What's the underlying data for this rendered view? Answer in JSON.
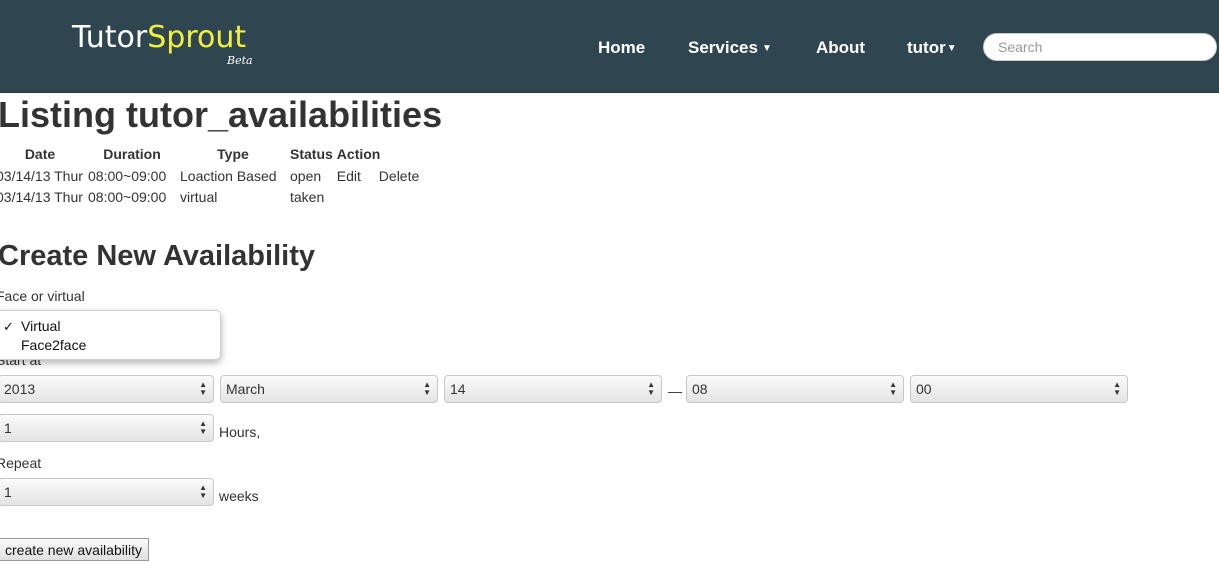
{
  "brand": {
    "name_part1": "Tutor",
    "name_part2": "Sprout",
    "tag": "Beta"
  },
  "nav": {
    "home": "Home",
    "services": "Services",
    "about": "About",
    "user": "tutor",
    "search_placeholder": "Search"
  },
  "colors": {
    "navbar": "#2f4650",
    "brand_accent": "#f4f13a"
  },
  "page_title": "Listing tutor_availabilities",
  "table": {
    "headers": [
      "Date",
      "Duration",
      "Type",
      "Status",
      "Action"
    ],
    "rows": [
      {
        "date": "03/14/13 Thur",
        "duration": "08:00~09:00",
        "type": "Loaction Based",
        "status": "open",
        "edit": "Edit",
        "delete": "Delete"
      },
      {
        "date": "03/14/13 Thur",
        "duration": "08:00~09:00",
        "type": "virtual",
        "status": "taken",
        "edit": "",
        "delete": ""
      }
    ]
  },
  "form": {
    "title": "Create New Availability",
    "face_label": "Face or virtual",
    "face_options": [
      "Virtual",
      "Face2face"
    ],
    "face_selected": "Virtual",
    "start_label": "Start at",
    "year": "2013",
    "month": "March",
    "day": "14",
    "separator": "—",
    "hour": "08",
    "minute": "00",
    "duration_value": "1",
    "duration_unit": "Hours,",
    "repeat_label": "Repeat",
    "repeat_value": "1",
    "repeat_unit": "weeks",
    "submit_label": "create new availability"
  }
}
